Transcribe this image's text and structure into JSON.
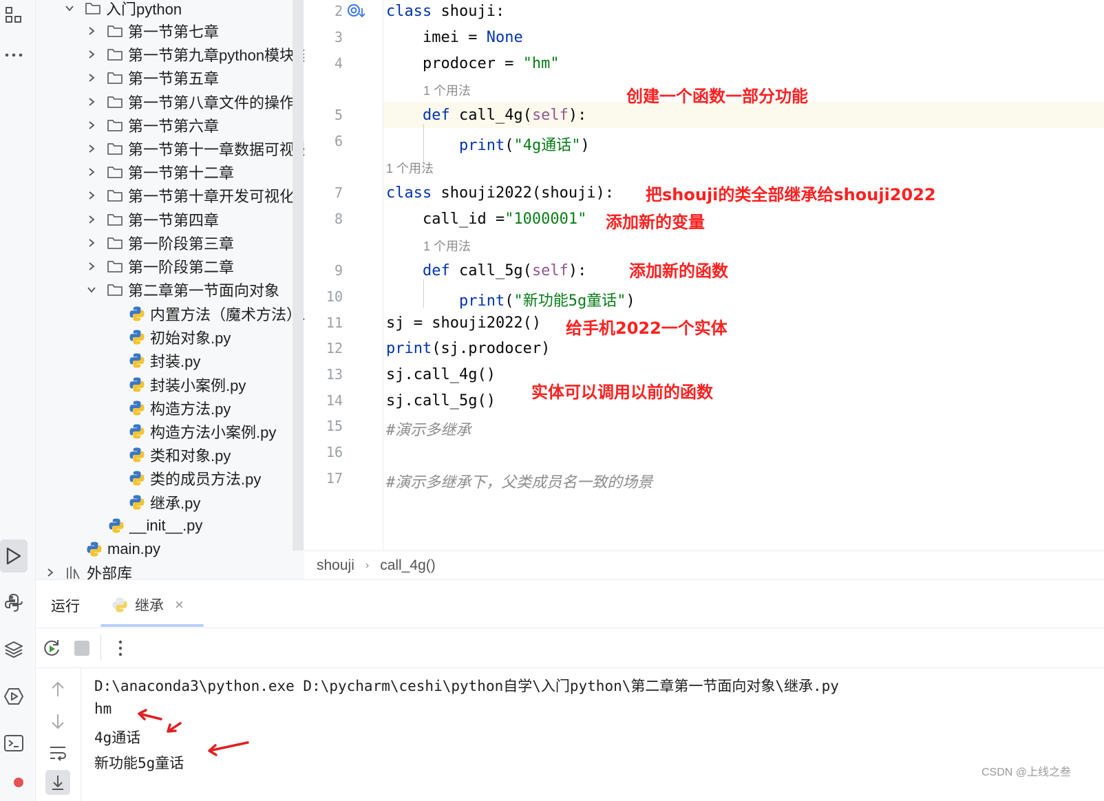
{
  "project_tree": {
    "root_label": "入门python",
    "folders": [
      "第一节第七章",
      "第一节第九章python模块与",
      "第一节第五章",
      "第一节第八章文件的操作",
      "第一节第六章",
      "第一节第十一章数据可视化",
      "第一节第十二章",
      "第一节第十章开发可视化",
      "第一节第四章",
      "第一阶段第三章",
      "第一阶段第二章",
      "第二章第一节面向对象"
    ],
    "files": [
      "内置方法（魔术方法）.py",
      "初始对象.py",
      "封装.py",
      "封装小案例.py",
      "构造方法.py",
      "构造方法小案例.py",
      "类和对象.py",
      "类的成员方法.py",
      "继承.py"
    ],
    "init_file": "__init__.py",
    "main_file": "main.py",
    "external_libs": "外部库"
  },
  "editor": {
    "line_numbers": [
      "2",
      "3",
      "4",
      "5",
      "6",
      "7",
      "8",
      "9",
      "10",
      "11",
      "12",
      "13",
      "14",
      "15",
      "16",
      "17"
    ],
    "usage_hint": "1 个用法",
    "code": {
      "l2_kw": "class",
      "l2_name": " shouji:",
      "l3_a": "    imei = ",
      "l3_b": "None",
      "l4_a": "    prodocer = ",
      "l4_b": "\"hm\"",
      "l5_kw": "    def",
      "l5_a": " call_4g(",
      "l5_self": "self",
      "l5_b": "):",
      "l6_a": "        ",
      "l6_fn": "print",
      "l6_b": "(",
      "l6_str": "\"4g通话\"",
      "l6_c": ")",
      "l7_kw": "class",
      "l7_name": " shouji2022(shouji):",
      "l8_a": "    call_id =",
      "l8_str": "\"1000001\"",
      "l9_kw": "    def",
      "l9_a": " call_5g(",
      "l9_self": "self",
      "l9_b": "):",
      "l10_a": "        ",
      "l10_fn": "print",
      "l10_b": "(",
      "l10_str": "\"新功能5g童话\"",
      "l10_c": ")",
      "l11": "sj = shouji2022()",
      "l12_fn": "print",
      "l12_b": "(sj.prodocer)",
      "l13": "sj.call_4g()",
      "l14": "sj.call_5g()",
      "l15": "#演示多继承",
      "l17": "#演示多继承下，父类成员名一致的场景"
    },
    "annotations": {
      "a1": "创建一个函数一部分功能",
      "a2": "把shouji的类全部继承给shouji2022",
      "a3": "添加新的变量",
      "a4": "添加新的函数",
      "a5": "给手机2022一个实体",
      "a6": "实体可以调用以前的函数"
    }
  },
  "breadcrumbs": [
    "shouji",
    "call_4g()"
  ],
  "run_panel": {
    "title": "运行",
    "tab_label": "继承",
    "output": [
      "D:\\anaconda3\\python.exe D:\\pycharm\\ceshi\\python自学\\入门python\\第二章第一节面向对象\\继承.py",
      "hm",
      "4g通话",
      "新功能5g童话"
    ]
  },
  "watermark": "CSDN @上线之叁",
  "colors": {
    "keyword": "#0033b3",
    "string": "#067d17",
    "self": "#94558d",
    "annotation": "#ff2020",
    "arrow": "#e02020"
  },
  "icons": [
    "structure-icon",
    "more-icon",
    "run-icon",
    "python-console-icon",
    "layers-icon",
    "services-icon",
    "terminal-icon",
    "folder-icon",
    "python-file-icon",
    "library-icon",
    "rerun-icon",
    "stop-icon",
    "kebab-menu-icon",
    "arrow-up-icon",
    "arrow-down-icon",
    "soft-wrap-icon",
    "scroll-end-icon",
    "close-icon",
    "bookmark-icon"
  ]
}
